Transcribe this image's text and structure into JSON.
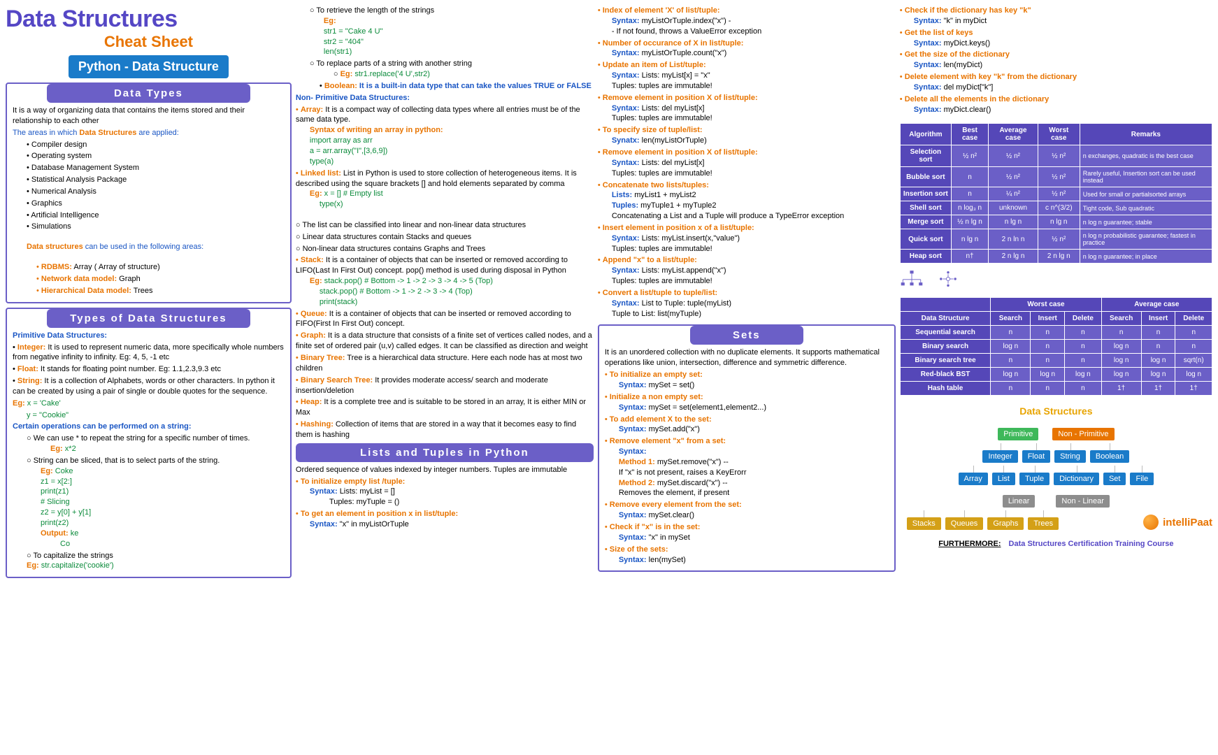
{
  "header": {
    "title": "Data Structures",
    "subtitle": "Cheat Sheet",
    "badge": "Python - Data Structure"
  },
  "section_titles": {
    "data_types": "Data Types",
    "types_ds": "Types of Data Structures",
    "lists_tuples": "Lists and Tuples in Python",
    "sets": "Sets",
    "ds_tree_root": "Data Structures"
  },
  "data_types": {
    "intro": "It is a way of organizing data that contains the items stored and their relationship to each other",
    "areas_label_pre": "The areas in which ",
    "areas_label_mid": "Data Structures",
    "areas_label_post": " are applied:",
    "areas": [
      "Compiler design",
      "Operating system",
      "Database Management System",
      "Statistical Analysis Package",
      "Numerical Analysis",
      "Graphics",
      "Artificial Intelligence",
      "Simulations"
    ],
    "used_label_pre": "Data structures",
    "used_label_post": " can be used in the following areas:",
    "models": [
      {
        "label": "RDBMS:",
        "value": " Array ( Array of structure)"
      },
      {
        "label": "Network data model:",
        "value": " Graph"
      },
      {
        "label": "Hierarchical Data model:",
        "value": " Trees"
      }
    ]
  },
  "types_ds": {
    "primitive_title": "Primitive Data Structures:",
    "items": [
      {
        "label": "Integer:",
        "body": " It is used to represent numeric data, more specifically whole numbers from negative infinity to infinity. Eg: 4, 5, -1 etc"
      },
      {
        "label": "Float:",
        "body": " It stands for floating point number. Eg: 1.1,2.3,9.3 etc"
      },
      {
        "label": "String:",
        "body": " It is a collection of Alphabets, words or other characters. In python it can be created by using a pair of single or double quotes for the sequence."
      }
    ],
    "eg_label": "Eg:",
    "eg_x": " x = 'Cake'",
    "eg_y": "y = \"Cookie\"",
    "ops_title": "Certain operations can be performed on a string:",
    "op1_desc": "We can use * to repeat the string for a specific number of times.",
    "op1_eg": "Eg:",
    "op1_val": " x*2",
    "op2_desc": "String can be sliced, that is to select parts of the string.",
    "op2_eg": "Eg:",
    "op2_val": " Coke",
    "op2_lines": [
      "z1 = x[2:]",
      "print(z1)",
      "# Slicing",
      "z2 = y[0] + y[1]",
      "print(z2)"
    ],
    "op2_out_label": "Output:",
    "op2_out_vals": [
      " ke",
      "Co"
    ],
    "op3_desc": "To capitalize the strings",
    "op3_eg": "Eg:",
    "op3_val": " str.capitalize('cookie')"
  },
  "col2_top": {
    "len_desc": "To retrieve the length of the strings",
    "len_eg": "Eg:",
    "len_lines": [
      "str1 = \"Cake 4 U\"",
      "str2 = \"404\"",
      "len(str1)"
    ],
    "replace_desc": "To replace parts of a string with another string",
    "replace_eg": "Eg:",
    "replace_val": " str1.replace('4 U',str2)",
    "bool_label": "Boolean:",
    "bool_body": " It is a built-in data type that can take the values TRUE or FALSE"
  },
  "nonprim": {
    "title": "Non- Primitive Data Structures:",
    "array_label": "Array:",
    "array_body": " It is a compact way of collecting data types where all entries must be of the same data type.",
    "array_syntax_label": "Syntax of writing an array in python:",
    "array_lines": [
      "import array as arr",
      "a = arr.array(\"I\",[3,6,9])",
      "type(a)"
    ],
    "ll_label": "Linked list:",
    "ll_body": " List in Python is used to store collection of heterogeneous items. It is described using the square brackets [] and hold elements separated by comma",
    "ll_eg": "Eg:",
    "ll_lines": [
      " x = [] # Empty list",
      "type(x)"
    ],
    "ll_classify": [
      "The list can be classified into linear and non-linear data structures",
      "Linear data structures contain Stacks and queues",
      "Non-linear data structures contains Graphs and Trees"
    ],
    "stack_label": "Stack:",
    "stack_body": " It is a container of objects that can be inserted or removed according to LIFO(Last In First Out) concept. pop() method is used during disposal in Python",
    "stack_eg": "Eg:",
    "stack_lines": [
      " stack.pop() # Bottom -> 1 -> 2 -> 3 -> 4 -> 5 (Top)",
      "stack.pop() # Bottom -> 1 -> 2 -> 3 -> 4 (Top)",
      "print(stack)"
    ],
    "queue_label": "Queue:",
    "queue_body": " It is a container of objects that can be inserted or removed according to FIFO(First In First Out) concept.",
    "graph_label": "Graph:",
    "graph_body": " It is a data structure that consists of a finite set of vertices called nodes, and a finite set of ordered pair (u,v) called edges. It can be classified as direction and weight",
    "bt_label": "Binary Tree:",
    "bt_body": " Tree is a hierarchical data structure. Here each node has at most two children",
    "bst_label": "Binary Search Tree:",
    "bst_body": " It provides moderate access/ search and moderate insertion/deletion",
    "heap_label": "Heap:",
    "heap_body": " It is a complete tree and is suitable to be stored in an array, It is either MIN or Max",
    "hash_label": "Hashing:",
    "hash_body": " Collection of items that are stored in a way that it becomes easy to find them is hashing"
  },
  "lists_tuples": {
    "intro": "Ordered sequence of values indexed by integer numbers. Tuples are immutable",
    "init_label": "To initialize empty list /tuple:",
    "init_list": "Syntax: ",
    "init_list_v": "Lists: myList = []",
    "init_tuple": "Tuples: myTuple = ()",
    "get_label": "To get an element in position x in list/tuple:",
    "get_syntax": "Syntax:",
    "get_val": " \"x\" in myListOrTuple"
  },
  "col3": {
    "items": [
      {
        "label": "Index of element 'X' of list/tuple:",
        "lines": [
          {
            "p": "Syntax:",
            "v": " myListOrTuple.index(\"x\") -"
          },
          {
            "p": "",
            "v": "- If not found, throws a ValueError exception"
          }
        ]
      },
      {
        "label": "Number of occurance of X in list/tuple:",
        "lines": [
          {
            "p": "Syntax:",
            "v": " myListOrTuple.count(\"x\")"
          }
        ]
      },
      {
        "label": "Update an item of List/tuple:",
        "lines": [
          {
            "p": "Syntax:",
            "v": " Lists: myList[x] = \"x\""
          },
          {
            "p": "",
            "v": "Tuples: tuples are immutable!"
          }
        ]
      },
      {
        "label": "Remove element in position X of list/tuple:",
        "lines": [
          {
            "p": "Syntax:",
            "v": " Lists: del myList[x]"
          },
          {
            "p": "",
            "v": "Tuples: tuples are immutable!"
          }
        ]
      },
      {
        "label": "To specify size of tuple/list:",
        "lines": [
          {
            "p": "Synatx:",
            "v": " len(myListOrTuple)"
          }
        ]
      },
      {
        "label": "Remove element in position X of list/tuple:",
        "lines": [
          {
            "p": "Syntax:",
            "v": " Lists: del myList[x]"
          },
          {
            "p": "",
            "v": "Tuples: tuples are immutable!"
          }
        ]
      },
      {
        "label": "Concatenate two lists/tuples:",
        "lines": [
          {
            "p": "Lists:",
            "v": " myList1 + myList2"
          },
          {
            "p": "Tuples:",
            "v": " myTuple1 + myTuple2"
          },
          {
            "p": "",
            "v": "Concatenating a List and a Tuple will produce a TypeError exception"
          }
        ]
      },
      {
        "label": "Insert element in position x of a list/tuple:",
        "lines": [
          {
            "p": "Syntax:",
            "v": " Lists: myList.insert(x,\"value\")"
          },
          {
            "p": "",
            "v": "Tuples: tuples are immutable!"
          }
        ]
      },
      {
        "label": "Append \"x\" to a list/tuple:",
        "lines": [
          {
            "p": "Syntax:",
            "v": " Lists: myList.append(\"x\")"
          },
          {
            "p": "",
            "v": "Tuples: tuples are immutable!"
          }
        ]
      },
      {
        "label": "Convert a list/tuple to tuple/list:",
        "lines": [
          {
            "p": "Syntax:",
            "v": " List to Tuple: tuple(myList)"
          },
          {
            "p": "",
            "v": "Tuple to List: list(myTuple)"
          }
        ]
      }
    ]
  },
  "sets": {
    "intro": "It is an unordered collection with no duplicate elements. It supports mathematical operations like union, intersection, difference and symmetric difference.",
    "items": [
      {
        "label": "To initialize an empty set:",
        "lines": [
          {
            "p": "Syntax:",
            "v": " mySet = set()"
          }
        ]
      },
      {
        "label": "Initialize a non empty set:",
        "lines": [
          {
            "p": "Syntax:",
            "v": " mySet = set(element1,element2...)"
          }
        ]
      },
      {
        "label": "To add element X to the set:",
        "lines": [
          {
            "p": "Syntax:",
            "v": " mySet.add(\"x\")"
          }
        ]
      },
      {
        "label": "Remove element \"x\" from a set:",
        "lines": [
          {
            "p": "Syntax:",
            "v": ""
          },
          {
            "p": "Method 1:",
            "v": " mySet.remove(\"x\") --",
            "orange": true
          },
          {
            "p": "",
            "v": "If \"x\" is not present, raises a KeyErorr"
          },
          {
            "p": "Method 2:",
            "v": " mySet.discard(\"x\") --",
            "orange": true
          },
          {
            "p": "",
            "v": "Removes the element, if present"
          }
        ]
      },
      {
        "label": "Remove every element from the set:",
        "lines": [
          {
            "p": "Syntax:",
            "v": " mySet.clear()"
          }
        ]
      },
      {
        "label": "Check if \"x\" is in the set:",
        "lines": [
          {
            "p": "Syntax:",
            "v": " \"x\" in mySet"
          }
        ]
      },
      {
        "label": "Size of the sets:",
        "lines": [
          {
            "p": "Syntax:",
            "v": " len(mySet)"
          }
        ]
      }
    ]
  },
  "col4_top": [
    {
      "label": "Check if the dictionary has key \"k\"",
      "lines": [
        {
          "p": "Syntax:",
          "v": " \"k\" in myDict"
        }
      ]
    },
    {
      "label": "Get the list of keys",
      "lines": [
        {
          "p": "Syntax:",
          "v": " myDict.keys()"
        }
      ]
    },
    {
      "label": "Get the size of the dictionary",
      "lines": [
        {
          "p": "Syntax:",
          "v": " len(myDict)"
        }
      ]
    },
    {
      "label": "Delete element with key \"k\" from the dictionary",
      "lines": [
        {
          "p": "Syntax:",
          "v": " del myDict[\"k\"]"
        }
      ]
    },
    {
      "label": "Delete all the elements in the dictionary",
      "lines": [
        {
          "p": "Syntax:",
          "v": " myDict.clear()"
        }
      ]
    }
  ],
  "table1": {
    "headers": [
      "Algorithm",
      "Best case",
      "Average case",
      "Worst case",
      "Remarks"
    ],
    "rows": [
      [
        "Selection sort",
        "½ n²",
        "½ n²",
        "½ n²",
        "n exchanges, quadratic is the best case"
      ],
      [
        "Bubble sort",
        "n",
        "½ n²",
        "½ n²",
        "Rarely useful, Insertion sort can be used instead"
      ],
      [
        "Insertion sort",
        "n",
        "¼ n²",
        "½ n²",
        "Used for small or partialsorted arrays"
      ],
      [
        "Shell sort",
        "n log₃ n",
        "unknown",
        "c n^(3/2)",
        "Tight code, Sub quadratic"
      ],
      [
        "Merge sort",
        "½ n lg n",
        "n lg n",
        "n lg n",
        "n log n guarantee; stable"
      ],
      [
        "Quick sort",
        "n lg n",
        "2 n ln n",
        "½ n²",
        "n log n probabilistic guarantee; fastest in practice"
      ],
      [
        "Heap sort",
        "n†",
        "2 n lg n",
        "2 n lg n",
        "n log n guarantee; in place"
      ]
    ]
  },
  "table2": {
    "groups": [
      "Worst case",
      "Average case"
    ],
    "headers": [
      "Data Structure",
      "Search",
      "Insert",
      "Delete",
      "Search",
      "Insert",
      "Delete"
    ],
    "rows": [
      [
        "Sequential search",
        "n",
        "n",
        "n",
        "n",
        "n",
        "n"
      ],
      [
        "Binary search",
        "log n",
        "n",
        "n",
        "log n",
        "n",
        "n"
      ],
      [
        "Binary search tree",
        "n",
        "n",
        "n",
        "log n",
        "log n",
        "sqrt(n)"
      ],
      [
        "Red-black BST",
        "log n",
        "log n",
        "log n",
        "log n",
        "log n",
        "log n"
      ],
      [
        "Hash table",
        "n",
        "n",
        "n",
        "1†",
        "1†",
        "1†"
      ]
    ]
  },
  "tree": {
    "primitive": "Primitive",
    "nonprimitive": "Non - Primitive",
    "prims": [
      "Integer",
      "Float",
      "String",
      "Boolean"
    ],
    "nonprims": [
      "Array",
      "List",
      "Tuple",
      "Dictionary",
      "Set",
      "File"
    ],
    "linear": "Linear",
    "nonlinear": "Non - Linear",
    "leaves": [
      "Stacks",
      "Queues",
      "Graphs",
      "Trees"
    ]
  },
  "logo": {
    "text_pre": "i",
    "text_orange": "ntelli",
    "text_post": "Paat"
  },
  "furthermore": {
    "label": "FURTHERMORE:",
    "link": "Data Structures Certification Training Course"
  }
}
